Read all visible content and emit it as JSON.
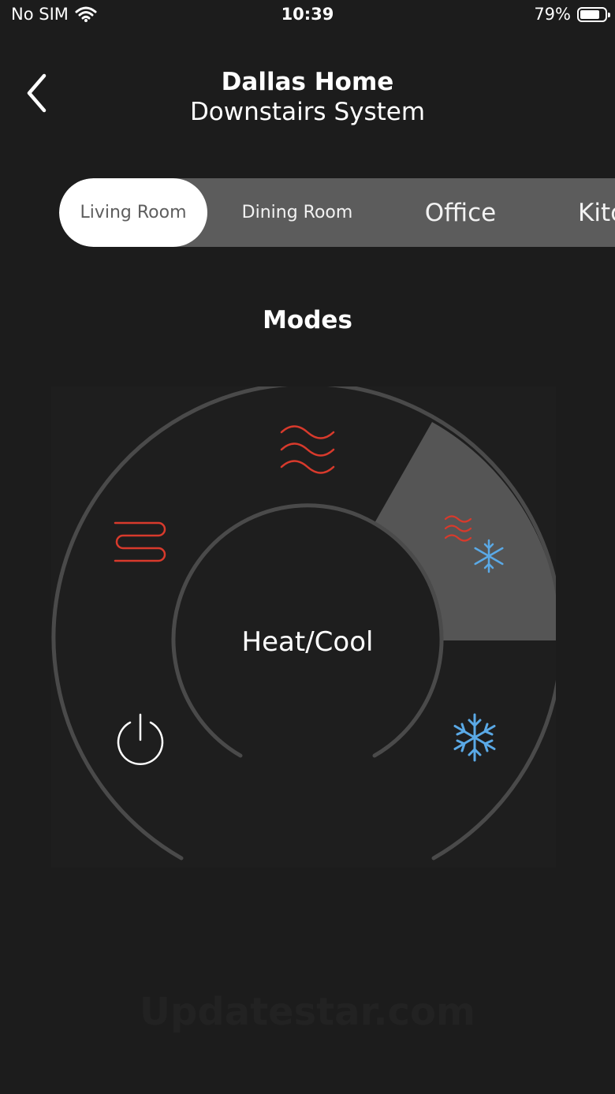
{
  "status_bar": {
    "carrier": "No SIM",
    "time": "10:39",
    "battery": "79%",
    "battery_level": 0.79
  },
  "header": {
    "title": "Dallas Home",
    "subtitle": "Downstairs System"
  },
  "rooms": {
    "tabs": [
      {
        "label": "Living Room",
        "active": true
      },
      {
        "label": "Dining Room",
        "active": false
      },
      {
        "label": "Office",
        "active": false
      },
      {
        "label": "Kitc",
        "active": false
      }
    ]
  },
  "modes": {
    "heading": "Modes",
    "current": "Heat/Cool",
    "options": [
      {
        "id": "off",
        "icon": "power-icon"
      },
      {
        "id": "emergency-heat",
        "icon": "heating-coil-icon"
      },
      {
        "id": "heat",
        "icon": "heat-waves-icon"
      },
      {
        "id": "heat-cool",
        "icon": "heat-cool-icon",
        "selected": true
      },
      {
        "id": "cool",
        "icon": "snowflake-icon"
      }
    ]
  },
  "colors": {
    "heat": "#d83a2c",
    "cool": "#5aa9e6",
    "selected_segment": "#555555",
    "ring": "#4a4a4a"
  },
  "watermark": "Updatestar.com"
}
